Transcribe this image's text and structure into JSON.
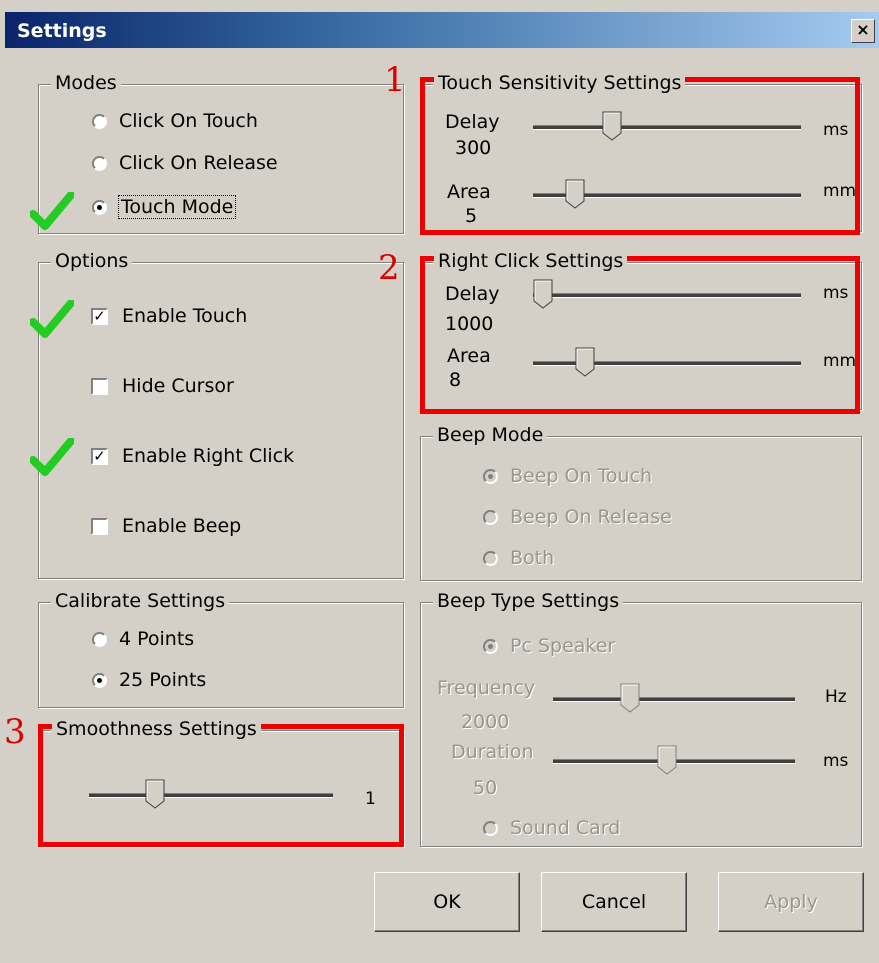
{
  "window": {
    "title": "Settings",
    "close_glyph": "×"
  },
  "modes": {
    "legend": "Modes",
    "options": [
      {
        "label": "Click On Touch",
        "selected": false
      },
      {
        "label": "Click On Release",
        "selected": false
      },
      {
        "label": "Touch Mode",
        "selected": true
      }
    ]
  },
  "options": {
    "legend": "Options",
    "items": [
      {
        "label": "Enable Touch",
        "checked": true
      },
      {
        "label": "Hide Cursor",
        "checked": false
      },
      {
        "label": "Enable Right Click",
        "checked": true
      },
      {
        "label": "Enable Beep",
        "checked": false
      }
    ]
  },
  "calibrate": {
    "legend": "Calibrate Settings",
    "options": [
      {
        "label": "4 Points",
        "selected": false
      },
      {
        "label": "25 Points",
        "selected": true
      }
    ]
  },
  "smoothness": {
    "legend": "Smoothness Settings",
    "value": "1",
    "level": 0.25
  },
  "touch_sensitivity": {
    "legend": "Touch Sensitivity Settings",
    "delay": {
      "label": "Delay",
      "value": "300",
      "unit": "ms",
      "level": 0.28
    },
    "area": {
      "label": "Area",
      "value": "5",
      "unit": "mm",
      "level": 0.13
    }
  },
  "right_click": {
    "legend": "Right Click Settings",
    "delay": {
      "label": "Delay",
      "value": "1000",
      "unit": "ms",
      "level": 0.0
    },
    "area": {
      "label": "Area",
      "value": "8",
      "unit": "mm",
      "level": 0.17
    }
  },
  "beep_mode": {
    "legend": "Beep Mode",
    "options": [
      {
        "label": "Beep On Touch",
        "selected": true
      },
      {
        "label": "Beep On Release",
        "selected": false
      },
      {
        "label": "Both",
        "selected": false
      }
    ]
  },
  "beep_type": {
    "legend": "Beep Type Settings",
    "pc_speaker": "Pc Speaker",
    "frequency": {
      "label": "Frequency",
      "value": "2000",
      "unit": "Hz",
      "level": 0.3
    },
    "duration": {
      "label": "Duration",
      "value": "50",
      "unit": "ms",
      "level": 0.47
    },
    "sound_card": "Sound Card"
  },
  "annotations": {
    "n1": "1",
    "n2": "2",
    "n3": "3",
    "annotation_color": "#e00000",
    "check_color": "#22cc22"
  },
  "buttons": {
    "ok": "OK",
    "cancel": "Cancel",
    "apply": "Apply"
  }
}
